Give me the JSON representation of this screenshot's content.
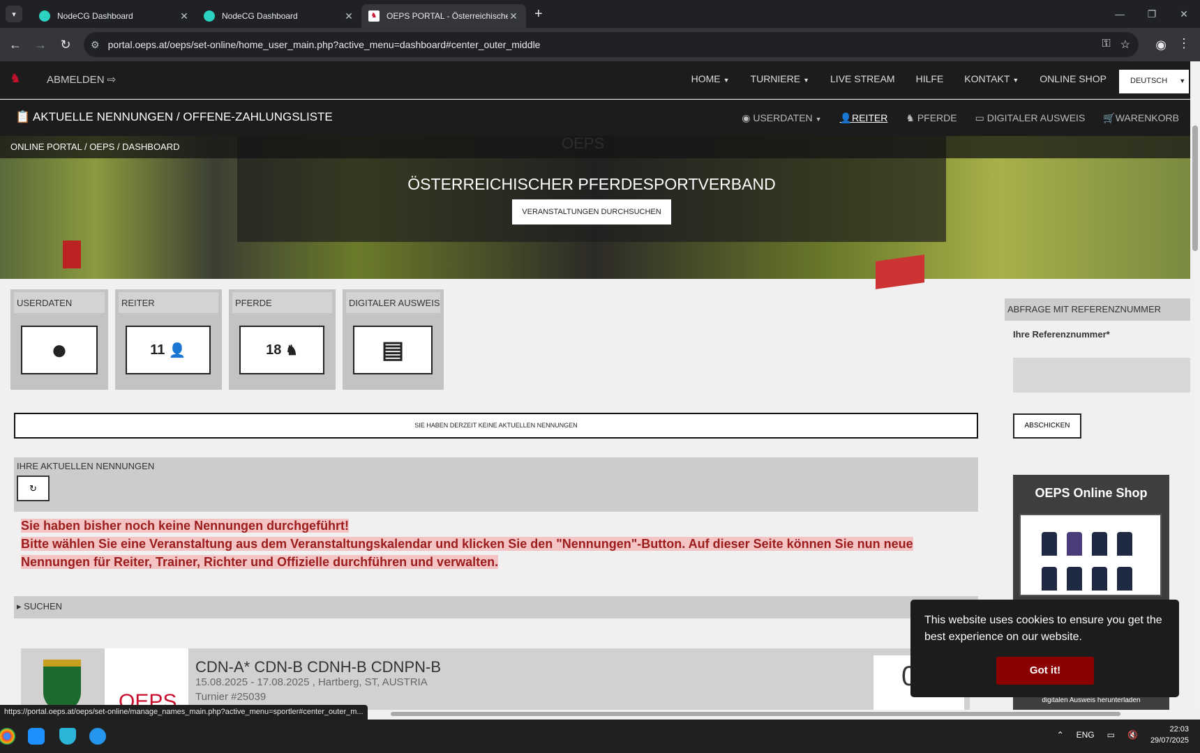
{
  "browser": {
    "tabs": [
      {
        "label": "NodeCG Dashboard",
        "active": false
      },
      {
        "label": "NodeCG Dashboard",
        "active": false
      },
      {
        "label": "OEPS PORTAL - Österreichischer",
        "active": true
      }
    ],
    "url": "portal.oeps.at/oeps/set-online/home_user_main.php?active_menu=dashboard#center_outer_middle",
    "status_url": "https://portal.oeps.at/oeps/set-online/manage_names_main.php?active_menu=sportler#center_outer_m..."
  },
  "topnav": {
    "logout": "ABMELDEN",
    "menu": [
      "HOME",
      "TURNIERE",
      "LIVE STREAM",
      "HILFE",
      "KONTAKT",
      "ONLINE SHOP"
    ],
    "language": "DEUTSCH"
  },
  "subnav": {
    "title": "AKTUELLE NENNUNGEN / OFFENE-ZAHLUNGSLISTE",
    "menu": [
      "USERDATEN",
      "REITER",
      "PFERDE",
      "DIGITALER AUSWEIS",
      "WARENKORB"
    ]
  },
  "breadcrumb": [
    "ONLINE PORTAL",
    "OEPS",
    "DASHBOARD"
  ],
  "hero": {
    "title": "ÖSTERREICHISCHER PFERDESPORTVERBAND",
    "button": "VERANSTALTUNGEN DURCHSUCHEN"
  },
  "tiles": [
    {
      "label": "USERDATEN",
      "value": "",
      "icon": "user-circle-icon"
    },
    {
      "label": "REITER",
      "value": "11",
      "icon": "person-icon"
    },
    {
      "label": "PFERDE",
      "value": "18",
      "icon": "horse-icon"
    },
    {
      "label": "DIGITALER AUSWEIS",
      "value": "",
      "icon": "id-card-icon"
    }
  ],
  "notice": "SIE HABEN DERZEIT KEINE AKTUELLEN NENNUNGEN",
  "current_section": {
    "label": "IHRE AKTUELLEN NENNUNGEN"
  },
  "alert": {
    "line1": "Sie haben bisher noch keine Nennungen durchgeführt!",
    "line2": "Bitte wählen Sie eine Veranstaltung aus dem Veranstaltungskalendar und klicken Sie den \"Nennungen\"-Button. Auf dieser Seite können Sie nun neue Nennungen für Reiter, Trainer, Richter und Offizielle durchführen und verwalten."
  },
  "search": {
    "label": "SUCHEN"
  },
  "event": {
    "name": "CDN-A* CDN-B CDNH-B CDNPN-B",
    "date": "15.08.2025 - 17.08.2025 , Hartberg, ST, AUSTRIA",
    "number": "Turnier #25039"
  },
  "sidebar": {
    "header": "ABFRAGE MIT REFERENZNUMMER",
    "label": "Ihre Referenznummer*",
    "button": "ABSCHICKEN",
    "shop_title": "OEPS Online Shop",
    "shop_footer": "digitalen Ausweis herunterladen"
  },
  "cookie": {
    "text": "This website uses cookies to ensure you get the best experience on our website.",
    "button": "Got it!"
  },
  "taskbar": {
    "lang": "ENG",
    "time": "22:03",
    "date": "29/07/2025"
  }
}
